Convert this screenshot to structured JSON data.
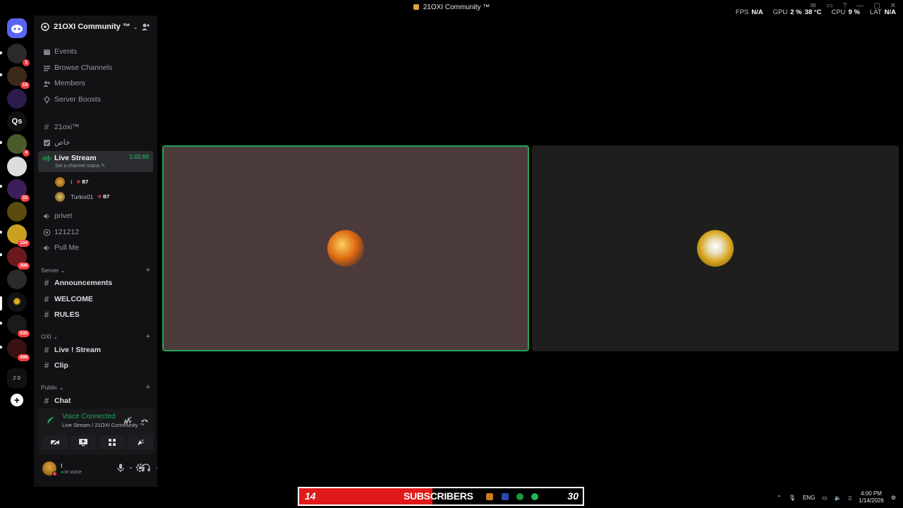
{
  "window": {
    "title": "21OXI Community ™",
    "overlay": {
      "fps_label": "FPS",
      "fps_value": "N/A",
      "gpu_label": "GPU",
      "gpu_value": "2 %",
      "gpu_temp": "38 °C",
      "cpu_label": "CPU",
      "cpu_value": "9 %",
      "lat_label": "LAT",
      "lat_value": "N/A"
    }
  },
  "rail": {
    "badges": [
      "1",
      "19",
      "4",
      "22",
      "104",
      "308",
      "535",
      "498"
    ],
    "text_server": "Qs",
    "dm_label": "2 D",
    "add_server": "+"
  },
  "server": {
    "name": "21OXI Community ™",
    "menu": [
      {
        "label": "Events",
        "icon": "calendar-icon"
      },
      {
        "label": "Browse Channels",
        "icon": "browse-icon"
      },
      {
        "label": "Members",
        "icon": "members-icon"
      },
      {
        "label": "Server Boosts",
        "icon": "boost-icon"
      }
    ],
    "channels_top": [
      {
        "label": "21oxi™",
        "type": "text"
      },
      {
        "label": "خاص",
        "type": "rules"
      }
    ],
    "live_stream": {
      "label": "Live Stream",
      "sub": "Set a channel status",
      "time": "1:02:00",
      "users": [
        {
          "name": "I",
          "tag": "B7"
        },
        {
          "name": "Turkix01",
          "tag": "B7"
        }
      ]
    },
    "voice_channels": [
      {
        "label": "privet",
        "icon": "speaker-icon"
      },
      {
        "label": "121212",
        "icon": "stage-icon"
      },
      {
        "label": "Pull Me",
        "icon": "speaker-icon"
      }
    ],
    "categories": [
      {
        "name": "Server",
        "channels": [
          "Announcements",
          "WELCOME",
          "RULES"
        ]
      },
      {
        "name": "OXI",
        "channels": [
          "Live ! Stream",
          "Clip"
        ]
      },
      {
        "name": "Public",
        "channels": [
          "Chat"
        ]
      }
    ]
  },
  "voice_panel": {
    "status": "Voice Connected",
    "location": "Live Stream / 21OXI Community ™"
  },
  "user_panel": {
    "name": "I",
    "status": "In voice"
  },
  "subscriber_bar": {
    "current": "14",
    "label": "SUBSCRIBERS",
    "goal": "30",
    "progress": 0.47
  },
  "tray": {
    "lang": "ENG",
    "time": "4:00 PM",
    "date": "1/14/2026"
  }
}
